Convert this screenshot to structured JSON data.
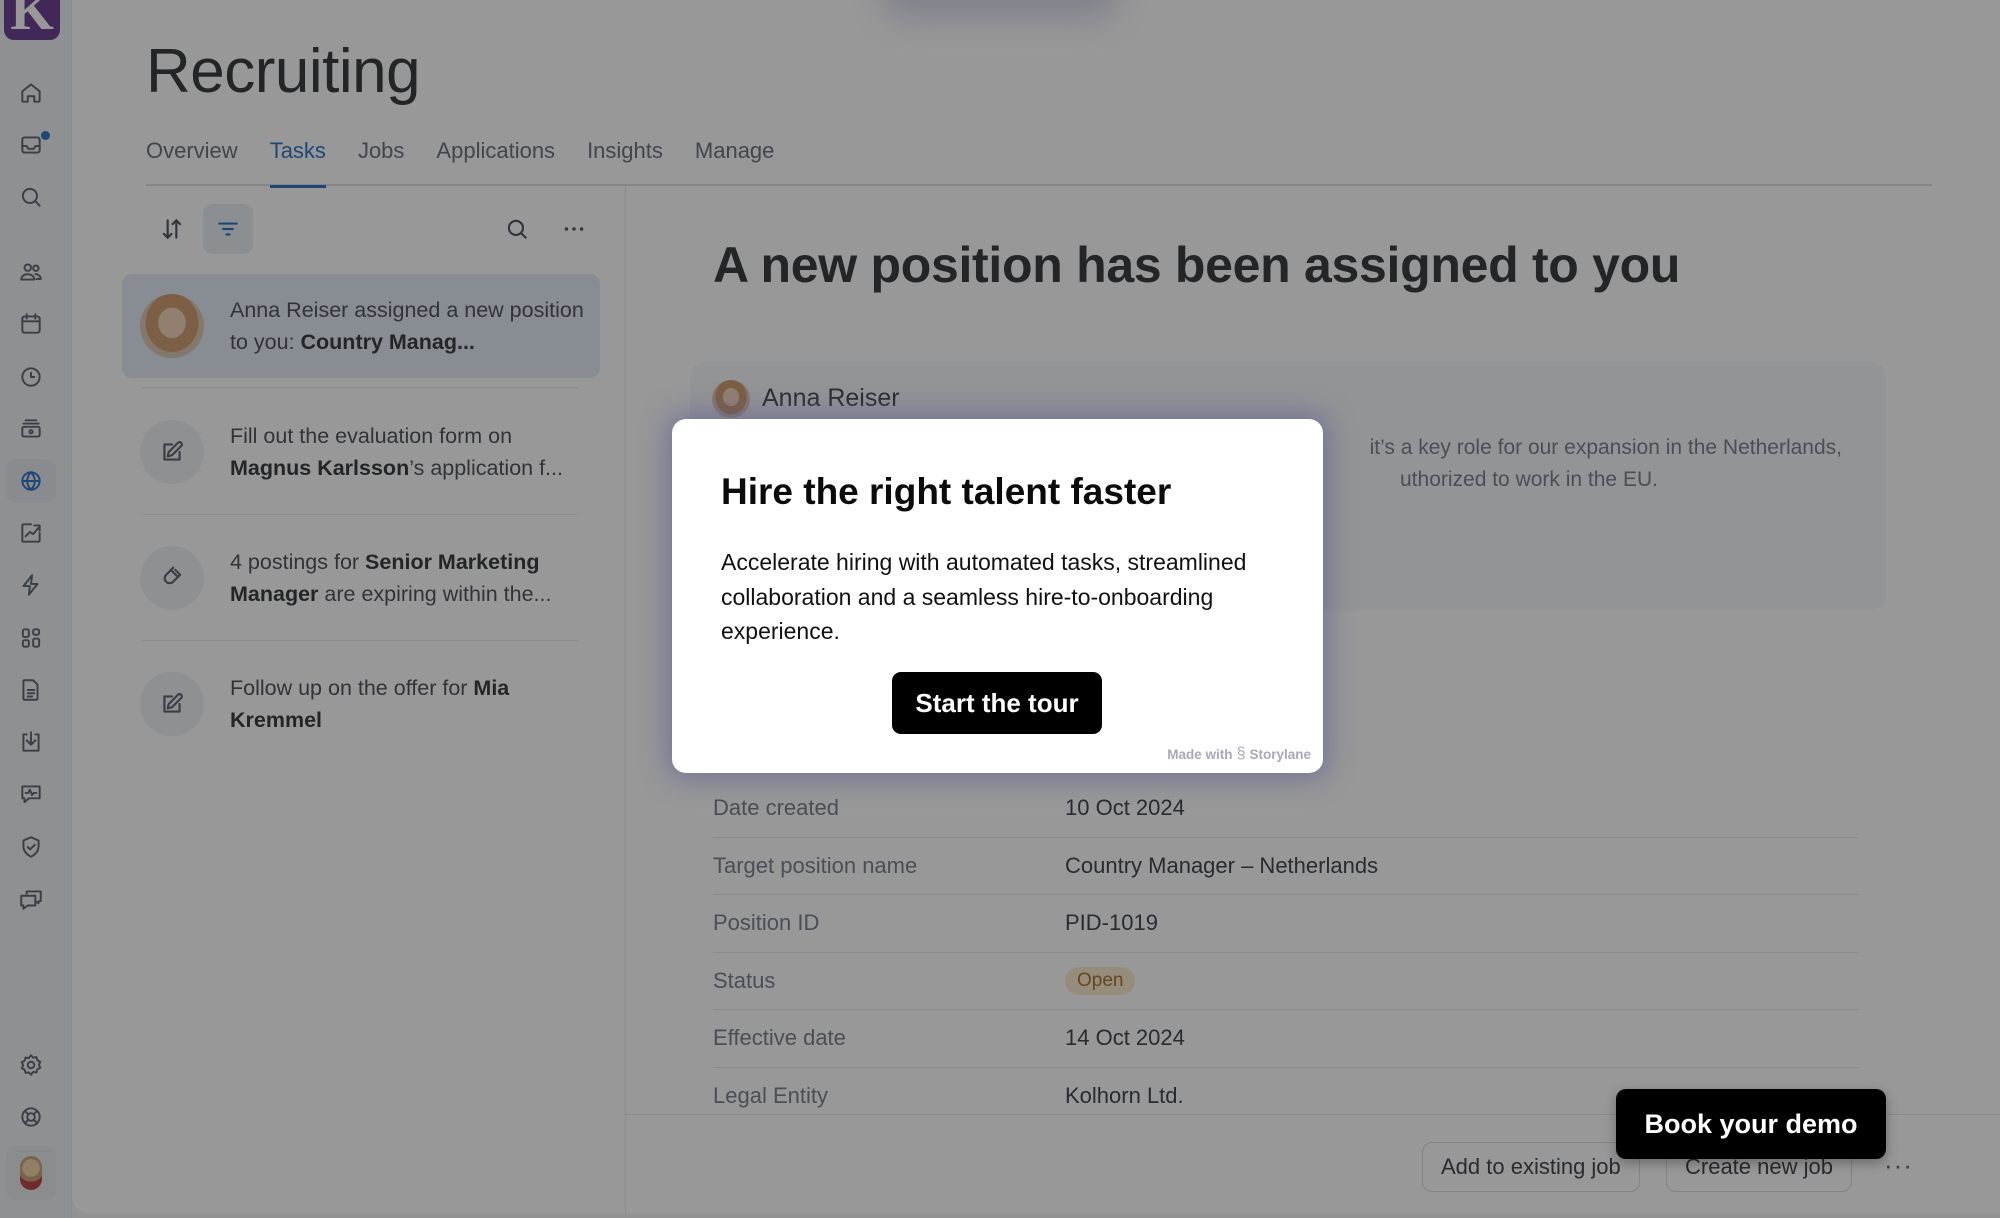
{
  "app": {
    "logo_letter": "K",
    "page_title": "Recruiting"
  },
  "sidebar": {
    "items": [
      {
        "name": "home",
        "icon": "home-icon"
      },
      {
        "name": "inbox",
        "icon": "inbox-icon",
        "has_notification": true
      },
      {
        "name": "search",
        "icon": "search-icon"
      },
      {
        "name": "people",
        "icon": "people-icon"
      },
      {
        "name": "calendar",
        "icon": "calendar-icon"
      },
      {
        "name": "time",
        "icon": "clock-icon"
      },
      {
        "name": "payroll",
        "icon": "money-icon"
      },
      {
        "name": "recruiting",
        "icon": "globe-icon",
        "active": true
      },
      {
        "name": "analytics",
        "icon": "chart-icon"
      },
      {
        "name": "automations",
        "icon": "lightning-icon"
      },
      {
        "name": "apps",
        "icon": "grid-icon"
      },
      {
        "name": "documents",
        "icon": "document-icon"
      },
      {
        "name": "imports",
        "icon": "download-icon"
      },
      {
        "name": "feedback",
        "icon": "pulse-message-icon"
      },
      {
        "name": "compliance",
        "icon": "shield-check-icon"
      },
      {
        "name": "messages",
        "icon": "chat-icon"
      }
    ],
    "bottom": [
      {
        "name": "settings",
        "icon": "gear-icon"
      },
      {
        "name": "help",
        "icon": "lifebuoy-icon"
      },
      {
        "name": "profile",
        "icon": "user-avatar"
      }
    ]
  },
  "tabs": [
    {
      "label": "Overview",
      "active": false
    },
    {
      "label": "Tasks",
      "active": true
    },
    {
      "label": "Jobs",
      "active": false
    },
    {
      "label": "Applications",
      "active": false
    },
    {
      "label": "Insights",
      "active": false
    },
    {
      "label": "Manage",
      "active": false
    }
  ],
  "task_list": {
    "toolbar": {
      "sort": "sort-icon",
      "filter": "filter-icon",
      "search": "search-icon",
      "more": "more-icon"
    },
    "tasks": [
      {
        "icon": "avatar",
        "pre": "Anna Reiser assigned a new position to you: ",
        "bold": "Country Manag...",
        "post": "",
        "selected": true
      },
      {
        "icon": "edit-icon",
        "pre": "Fill out the evaluation form on ",
        "bold": "Magnus Karlsson",
        "post": "’s application f...",
        "selected": false
      },
      {
        "icon": "magnet-icon",
        "pre": "4 postings for ",
        "bold": "Senior Marketing Manager",
        "post": " are expiring within the...",
        "selected": false
      },
      {
        "icon": "edit-icon",
        "pre": "Follow up on the offer for ",
        "bold": "Mia Kremmel",
        "post": "",
        "selected": false
      }
    ]
  },
  "detail": {
    "title": "A new position has been assigned to you",
    "message": {
      "author": "Anna Reiser",
      "visible_line_1": "it’s a key role for our expansion in the Netherlands,",
      "visible_line_2": "uthorized to work in the EU."
    },
    "fields": [
      {
        "label": "Date created",
        "value": "10 Oct 2024"
      },
      {
        "label": "Target position name",
        "value": "Country Manager – Netherlands"
      },
      {
        "label": "Position ID",
        "value": "PID-1019"
      },
      {
        "label": "Status",
        "value": "Open",
        "badge": true
      },
      {
        "label": "Effective date",
        "value": "14 Oct 2024"
      },
      {
        "label": "Legal Entity",
        "value": "Kolhorn Ltd."
      }
    ],
    "actions": {
      "add_existing": "Add to existing job",
      "create_new": "Create new job",
      "more": "···"
    }
  },
  "modal": {
    "title": "Hire the right talent faster",
    "body": "Accelerate hiring with automated tasks, streamlined collaboration and a seamless hire-to-onboarding experience.",
    "cta": "Start the tour",
    "made_with": "Made with",
    "brand": "Storylane"
  },
  "book_demo": "Book your demo",
  "colors": {
    "accent": "#1565c0",
    "logo": "#5b2a86",
    "badge_open_bg": "#fbe8c8",
    "badge_open_text": "#a0631a"
  }
}
